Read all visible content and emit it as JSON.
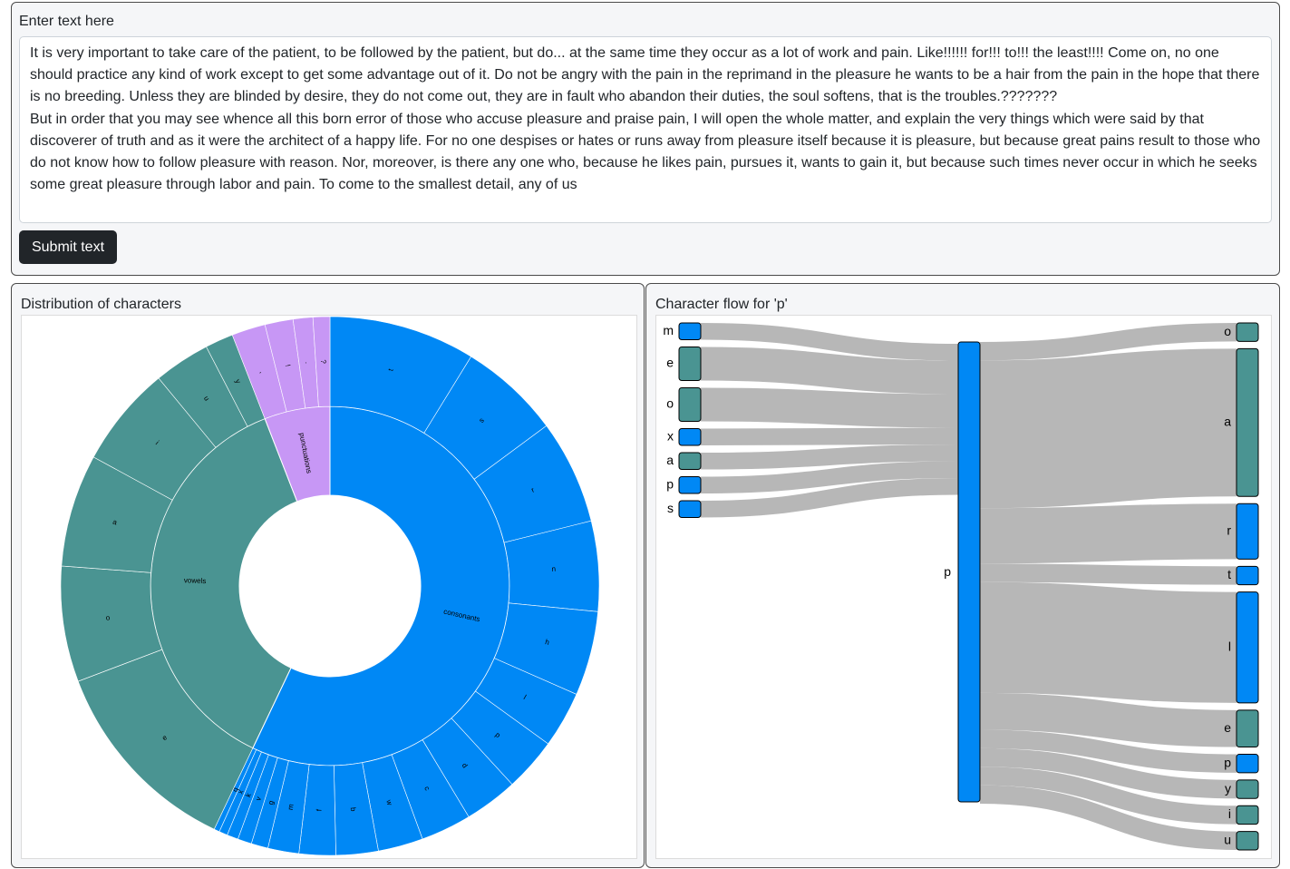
{
  "input": {
    "title": "Enter text here",
    "text": "It is very important to take care of the patient, to be followed by the patient, but do... at the same time they occur as a lot of work and pain. Like!!!!!! for!!! to!!! the least!!!! Come on, no one should practice any kind of work except to get some advantage out of it. Do not be angry with the pain in the reprimand in the pleasure he wants to be a hair from the pain in the hope that there is no breeding. Unless they are blinded by desire, they do not come out, they are in fault who abandon their duties, the soul softens, that is the troubles.???????\nBut in order that you may see whence all this born error of those who accuse pleasure and praise pain, I will open the whole matter, and explain the very things which were said by that discoverer of truth and as it were the architect of a happy life. For no one despises or hates or runs away from pleasure itself because it is pleasure, but because great pains result to those who do not know how to follow pleasure with reason. Nor, moreover, is there any one who, because he likes pain, pursues it, wants to gain it, but because such times never occur in which he seeks some great pleasure through labor and pain. To come to the smallest detail, any of us",
    "submit_label": "Submit text"
  },
  "distribution": {
    "title": "Distribution of characters"
  },
  "flow": {
    "title": "Character flow for 'p'"
  },
  "colors": {
    "consonants": "#0088f5",
    "vowels": "#4a9492",
    "punctuations": "#c797f5",
    "link": "#b7b7b7"
  },
  "chart_data": [
    {
      "type": "sunburst",
      "groups": [
        {
          "name": "consonants",
          "color_key": "consonants",
          "children": [
            {
              "name": "t",
              "value": 10.76
            },
            {
              "name": "s",
              "value": 7.45
            },
            {
              "name": "r",
              "value": 7.66
            },
            {
              "name": "n",
              "value": 6.62
            },
            {
              "name": "h",
              "value": 6.21
            },
            {
              "name": "l",
              "value": 4.14
            },
            {
              "name": "p",
              "value": 3.93
            },
            {
              "name": "d",
              "value": 3.93
            },
            {
              "name": "c",
              "value": 3.72
            },
            {
              "name": "w",
              "value": 3.31
            },
            {
              "name": "b",
              "value": 3.1
            },
            {
              "name": "f",
              "value": 2.69
            },
            {
              "name": "m",
              "value": 2.28
            },
            {
              "name": "g",
              "value": 1.24
            },
            {
              "name": "v",
              "value": 1.03
            },
            {
              "name": "k",
              "value": 0.83
            },
            {
              "name": "x",
              "value": 0.62
            },
            {
              "name": "q",
              "value": 0.41
            }
          ]
        },
        {
          "name": "vowels",
          "color_key": "vowels",
          "children": [
            {
              "name": "e",
              "value": 14.91
            },
            {
              "name": "o",
              "value": 8.5
            },
            {
              "name": "a",
              "value": 8.28
            },
            {
              "name": "i",
              "value": 7.45
            },
            {
              "name": "u",
              "value": 4.14
            },
            {
              "name": "y",
              "value": 2.07
            }
          ]
        },
        {
          "name": "punctuations",
          "color_key": "punctuations",
          "children": [
            {
              "name": ",",
              "value": 2.48
            },
            {
              "name": "!",
              "value": 2.07
            },
            {
              "name": ".",
              "value": 1.45
            },
            {
              "name": "?",
              "value": 1.24
            }
          ]
        }
      ]
    },
    {
      "type": "sankey",
      "center": {
        "label": "p",
        "color_key": "consonants"
      },
      "sources": [
        {
          "label": "m",
          "value": 1,
          "color_key": "consonants"
        },
        {
          "label": "e",
          "value": 2,
          "color_key": "vowels"
        },
        {
          "label": "o",
          "value": 2,
          "color_key": "vowels"
        },
        {
          "label": "x",
          "value": 1,
          "color_key": "consonants"
        },
        {
          "label": "a",
          "value": 1,
          "color_key": "vowels"
        },
        {
          "label": "p",
          "value": 1,
          "color_key": "consonants"
        },
        {
          "label": "s",
          "value": 1,
          "color_key": "consonants"
        }
      ],
      "targets": [
        {
          "label": "o",
          "value": 1,
          "color_key": "vowels"
        },
        {
          "label": "a",
          "value": 8,
          "color_key": "vowels"
        },
        {
          "label": "r",
          "value": 3,
          "color_key": "consonants"
        },
        {
          "label": "t",
          "value": 1,
          "color_key": "consonants"
        },
        {
          "label": "l",
          "value": 6,
          "color_key": "consonants"
        },
        {
          "label": "e",
          "value": 2,
          "color_key": "vowels"
        },
        {
          "label": "p",
          "value": 1,
          "color_key": "consonants"
        },
        {
          "label": "y",
          "value": 1,
          "color_key": "vowels"
        },
        {
          "label": "i",
          "value": 1,
          "color_key": "vowels"
        },
        {
          "label": "u",
          "value": 1,
          "color_key": "vowels"
        }
      ]
    }
  ]
}
